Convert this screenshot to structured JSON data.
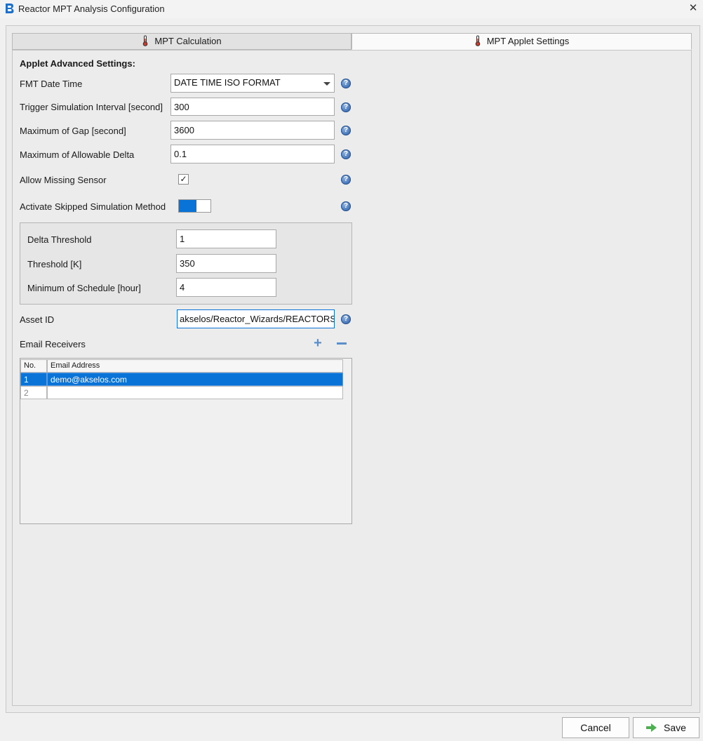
{
  "window": {
    "title": "Reactor MPT Analysis Configuration",
    "close": "✕"
  },
  "tabs": [
    {
      "label": "MPT Calculation",
      "active": false
    },
    {
      "label": "MPT Applet Settings",
      "active": true
    }
  ],
  "section": {
    "heading": "Applet Advanced Settings:"
  },
  "fields": {
    "fmt_date_time": {
      "label": "FMT Date Time",
      "value": "DATE TIME ISO FORMAT"
    },
    "trigger_interval": {
      "label": "Trigger Simulation Interval [second]",
      "value": "300"
    },
    "max_gap": {
      "label": "Maximum of Gap [second]",
      "value": "3600"
    },
    "max_delta": {
      "label": "Maximum of Allowable Delta",
      "value": "0.1"
    },
    "allow_missing_sensor": {
      "label": "Allow Missing Sensor",
      "checked": true,
      "glyph": "✓"
    },
    "activate_skipped": {
      "label": "Activate Skipped Simulation Method",
      "on": true
    },
    "delta_threshold": {
      "label": "Delta Threshold",
      "value": "1"
    },
    "threshold_k": {
      "label": "Threshold [K]",
      "value": "350"
    },
    "min_schedule": {
      "label": "Minimum of Schedule [hour]",
      "value": "4"
    },
    "asset_id": {
      "label": "Asset ID",
      "value": "akselos/Reactor_Wizards/REACTORS"
    }
  },
  "help_glyph": "?",
  "email": {
    "label": "Email Receivers",
    "add": "+",
    "columns": [
      "No.",
      "Email Address"
    ],
    "rows": [
      {
        "no": "1",
        "address": "demo@akselos.com",
        "selected": true
      },
      {
        "no": "2",
        "address": "",
        "selected": false
      }
    ]
  },
  "buttons": {
    "cancel": "Cancel",
    "save": "Save"
  },
  "colors": {
    "accent": "#0a73d8",
    "help": "#3d6fb5",
    "save_arrow": "#4caf50"
  }
}
